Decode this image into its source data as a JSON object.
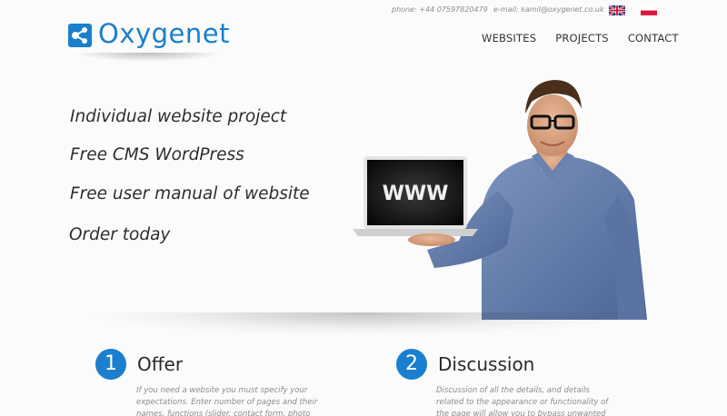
{
  "topbar": {
    "phone": "phone: +44 07597820479",
    "email": "e-mail: kamil@oxygenet.co.uk"
  },
  "logo": {
    "text": "Oxygenet",
    "color": "#1a7fce"
  },
  "nav": {
    "items": [
      {
        "label": "WEBSITES"
      },
      {
        "label": "PROJECTS"
      },
      {
        "label": "CONTACT"
      }
    ]
  },
  "hero": {
    "lines": [
      "Individual website project",
      "Free CMS WordPress",
      "Free user manual of website",
      "Order today"
    ],
    "laptop_screen_text": "WWW"
  },
  "steps": [
    {
      "number": "1",
      "title": "Offer",
      "text": "If you need a website you must specify your expectations. Enter number of pages and their names, functions (slider, contact form, photo"
    },
    {
      "number": "2",
      "title": "Discussion",
      "text": "Discussion of all the details, and details related to the appearance or functionality of the page will allow you to bypass unwanted mistakes and"
    }
  ],
  "colors": {
    "accent": "#1a7fce"
  }
}
